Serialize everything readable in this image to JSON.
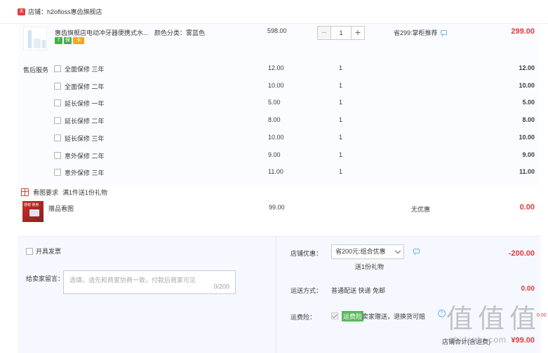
{
  "shop": {
    "logo": "天猫",
    "label": "店铺：h2ofloss惠齿旗舰店"
  },
  "product": {
    "title": "惠齿旗舰店电动冲牙器便携式水...",
    "color": "颜色分类：雾蓝色",
    "price": "598.00",
    "quantity": "1",
    "minus": "−",
    "plus": "+",
    "promo": "省299:掌柜推荐",
    "total": "299.00",
    "badges": [
      "7",
      "保",
      "卡"
    ]
  },
  "service_label": "售后服务",
  "services": [
    {
      "name": "全面保修 三年",
      "price": "12.00",
      "qty": "1",
      "total": "12.00"
    },
    {
      "name": "全面保修 二年",
      "price": "10.00",
      "qty": "1",
      "total": "10.00"
    },
    {
      "name": "延长保修 一年",
      "price": "5.00",
      "qty": "1",
      "total": "5.00"
    },
    {
      "name": "延长保修 二年",
      "price": "8.00",
      "qty": "1",
      "total": "8.00"
    },
    {
      "name": "延长保修 三年",
      "price": "10.00",
      "qty": "1",
      "total": "10.00"
    },
    {
      "name": "意外保修 二年",
      "price": "9.00",
      "qty": "1",
      "total": "9.00"
    },
    {
      "name": "意外保修 三年",
      "price": "11.00",
      "qty": "1",
      "total": "11.00"
    }
  ],
  "gift": {
    "header": "看图要求",
    "rule": "满1件送1份礼物",
    "name": "赠品看图",
    "price": "99.00",
    "promo": "无优惠",
    "total": "0.00",
    "image_text": "感谢 使用"
  },
  "invoice_label": "开具发票",
  "memo": {
    "label": "给卖家留言：",
    "placeholder": "选填，请先和商家协商一致，付款后商家可见",
    "count": "0/200"
  },
  "coupon": {
    "label": "店铺优惠：",
    "selected": "省200元:组合优惠",
    "gift": "送1份礼物",
    "discount": "-200.00"
  },
  "shipping": {
    "label": "运送方式：",
    "method": "普通配送 快递 免邮",
    "fee": "0.00"
  },
  "insurance": {
    "label": "运费险：",
    "tag": "运费险",
    "desc": "卖家赠送，退换货可赔",
    "help": "?",
    "extra": "0.00"
  },
  "total": {
    "label": "店铺合计(含运费)",
    "value": "¥99.00"
  },
  "watermark": {
    "glyph": "值",
    "text": "zhidezhi.com"
  },
  "colors": {
    "accent": "#e4393c",
    "panel": "#f5f8ff"
  }
}
